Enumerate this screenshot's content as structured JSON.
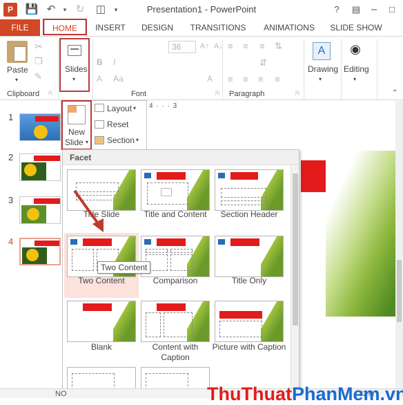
{
  "window": {
    "title": "Presentation1 - PowerPoint",
    "help": "?"
  },
  "tabs": {
    "file": "FILE",
    "home": "HOME",
    "insert": "INSERT",
    "design": "DESIGN",
    "transitions": "TRANSITIONS",
    "animations": "ANIMATIONS",
    "slideshow": "SLIDE SHOW"
  },
  "ribbon": {
    "paste": "Paste",
    "slides": "Slides",
    "font_size": "36",
    "drawing": "Drawing",
    "editing": "Editing",
    "groups": {
      "clipboard": "Clipboard",
      "font": "Font",
      "paragraph": "Paragraph"
    }
  },
  "new_slide_menu": {
    "new_slide": "New",
    "new_slide_2": "Slide",
    "layout": "Layout",
    "reset": "Reset",
    "section": "Section",
    "theme_name": "Facet",
    "tooltip": "Two Content",
    "layouts": [
      {
        "name": "Title Slide"
      },
      {
        "name": "Title and Content"
      },
      {
        "name": "Section Header"
      },
      {
        "name": "Two Content"
      },
      {
        "name": "Comparison"
      },
      {
        "name": "Title Only"
      },
      {
        "name": "Blank"
      },
      {
        "name": "Content with Caption"
      },
      {
        "name": "Picture with Caption"
      }
    ]
  },
  "slides": {
    "numbers": [
      "1",
      "2",
      "3",
      "4"
    ]
  },
  "ruler": "4 · · · 3",
  "status": {
    "left": "NO",
    "zoom": "32%"
  },
  "watermark": {
    "a": "Thu",
    "b": "Thuat",
    "c": "Phan",
    "d": "Mem",
    "e": ".vn"
  },
  "colors": {
    "accent": "#d24726",
    "highlight_box": "#b93a3a",
    "brand_green": "#6b9a2a"
  }
}
